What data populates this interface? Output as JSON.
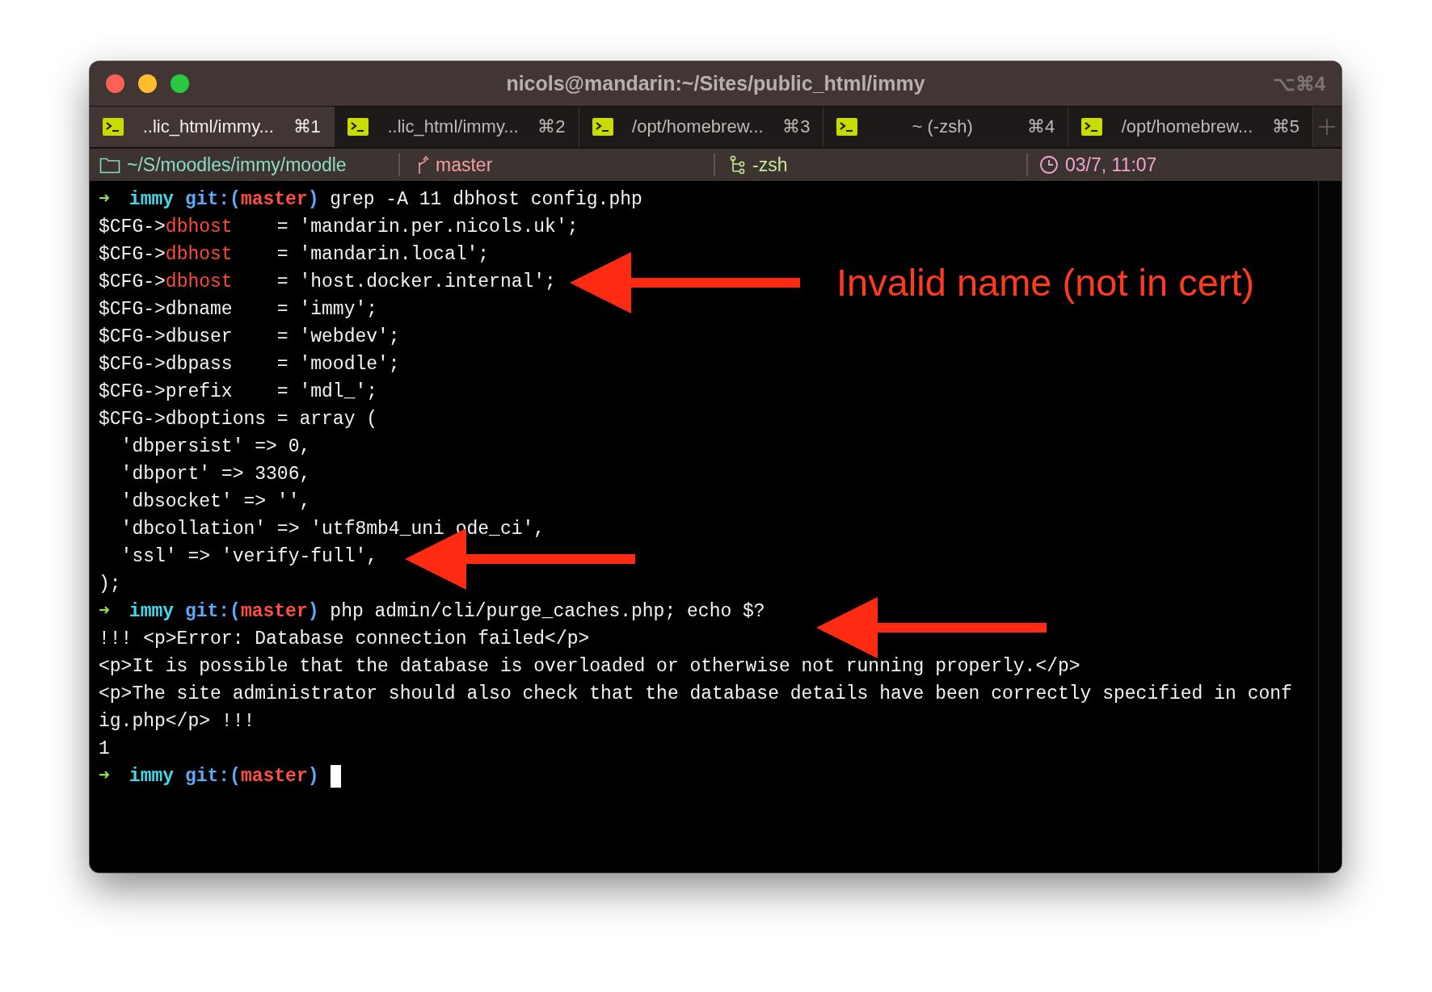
{
  "window": {
    "title": "nicols@mandarin:~/Sites/public_html/immy",
    "shortcut": "⌥⌘4"
  },
  "tabs": [
    {
      "label": "..lic_html/immy...",
      "shortcut": "⌘1",
      "selected": true
    },
    {
      "label": "..lic_html/immy...",
      "shortcut": "⌘2",
      "selected": false
    },
    {
      "label": "/opt/homebrew...",
      "shortcut": "⌘3",
      "selected": false
    },
    {
      "label": "~ (-zsh)",
      "shortcut": "⌘4",
      "selected": false
    },
    {
      "label": "/opt/homebrew...",
      "shortcut": "⌘5",
      "selected": false
    }
  ],
  "status_bar": [
    {
      "kind": "folder",
      "text": "~/S/moodles/immy/moodle"
    },
    {
      "kind": "branch",
      "text": "master"
    },
    {
      "kind": "shell",
      "text": "-zsh"
    },
    {
      "kind": "clock",
      "text": "03/7, 11:07"
    }
  ],
  "terminal": {
    "cursor_visible": true,
    "lines": [
      [
        {
          "kind": "arrow",
          "text": "➜"
        },
        {
          "kind": "dir",
          "text": "immy"
        },
        {
          "kind": "git",
          "text": " git:("
        },
        {
          "kind": "branch",
          "text": "master"
        },
        {
          "kind": "git",
          "text": ")"
        },
        {
          "kind": "plain",
          "text": " grep -A 11 dbhost config.php"
        }
      ],
      [
        {
          "kind": "plain",
          "text": "$CFG->"
        },
        {
          "kind": "key",
          "text": "dbhost"
        },
        {
          "kind": "plain",
          "text": "    = 'mandarin.per.nicols.uk';"
        }
      ],
      [
        {
          "kind": "plain",
          "text": "$CFG->"
        },
        {
          "kind": "key",
          "text": "dbhost"
        },
        {
          "kind": "plain",
          "text": "    = 'mandarin.local';"
        }
      ],
      [
        {
          "kind": "plain",
          "text": "$CFG->"
        },
        {
          "kind": "key",
          "text": "dbhost"
        },
        {
          "kind": "plain",
          "text": "    = 'host.docker.internal';"
        }
      ],
      [
        {
          "kind": "plain",
          "text": "$CFG->dbname    = 'immy';"
        }
      ],
      [
        {
          "kind": "plain",
          "text": "$CFG->dbuser    = 'webdev';"
        }
      ],
      [
        {
          "kind": "plain",
          "text": "$CFG->dbpass    = 'moodle';"
        }
      ],
      [
        {
          "kind": "plain",
          "text": "$CFG->prefix    = 'mdl_';"
        }
      ],
      [
        {
          "kind": "plain",
          "text": "$CFG->dboptions = array ("
        }
      ],
      [
        {
          "kind": "plain",
          "text": "  'dbpersist' => 0,"
        }
      ],
      [
        {
          "kind": "plain",
          "text": "  'dbport' => 3306,"
        }
      ],
      [
        {
          "kind": "plain",
          "text": "  'dbsocket' => '',"
        }
      ],
      [
        {
          "kind": "plain",
          "text": "  'dbcollation' => 'utf8mb4_uni"
        },
        {
          "kind": "resume",
          "text": "ode_ci',"
        }
      ],
      [
        {
          "kind": "plain",
          "text": "  'ssl' => 'verify-full',"
        }
      ],
      [
        {
          "kind": "plain",
          "text": ");"
        }
      ],
      [
        {
          "kind": "arrow",
          "text": "➜"
        },
        {
          "kind": "dir",
          "text": "immy"
        },
        {
          "kind": "git",
          "text": " git:("
        },
        {
          "kind": "branch",
          "text": "master"
        },
        {
          "kind": "git",
          "text": ")"
        },
        {
          "kind": "plain",
          "text": " php admin/cli/purge_caches.php; echo $?"
        }
      ],
      [
        {
          "kind": "plain",
          "text": "!!! <p>Error: Database connection failed</p>"
        }
      ],
      [
        {
          "kind": "plain",
          "text": "<p>It is possible that the database is overloaded or otherwise not running properly.</p>"
        }
      ],
      [
        {
          "kind": "plain",
          "text": "<p>The site administrator should also check that the database details have been correctly specified in conf"
        }
      ],
      [
        {
          "kind": "plain",
          "text": "ig.php</p> !!!"
        }
      ],
      [
        {
          "kind": "plain",
          "text": "1"
        }
      ],
      [
        {
          "kind": "arrow",
          "text": "➜"
        },
        {
          "kind": "dir",
          "text": "immy"
        },
        {
          "kind": "git",
          "text": " git:("
        },
        {
          "kind": "branch",
          "text": "master"
        },
        {
          "kind": "git",
          "text": ")"
        }
      ]
    ]
  },
  "annotation": {
    "text": "Invalid name (not in cert)"
  }
}
